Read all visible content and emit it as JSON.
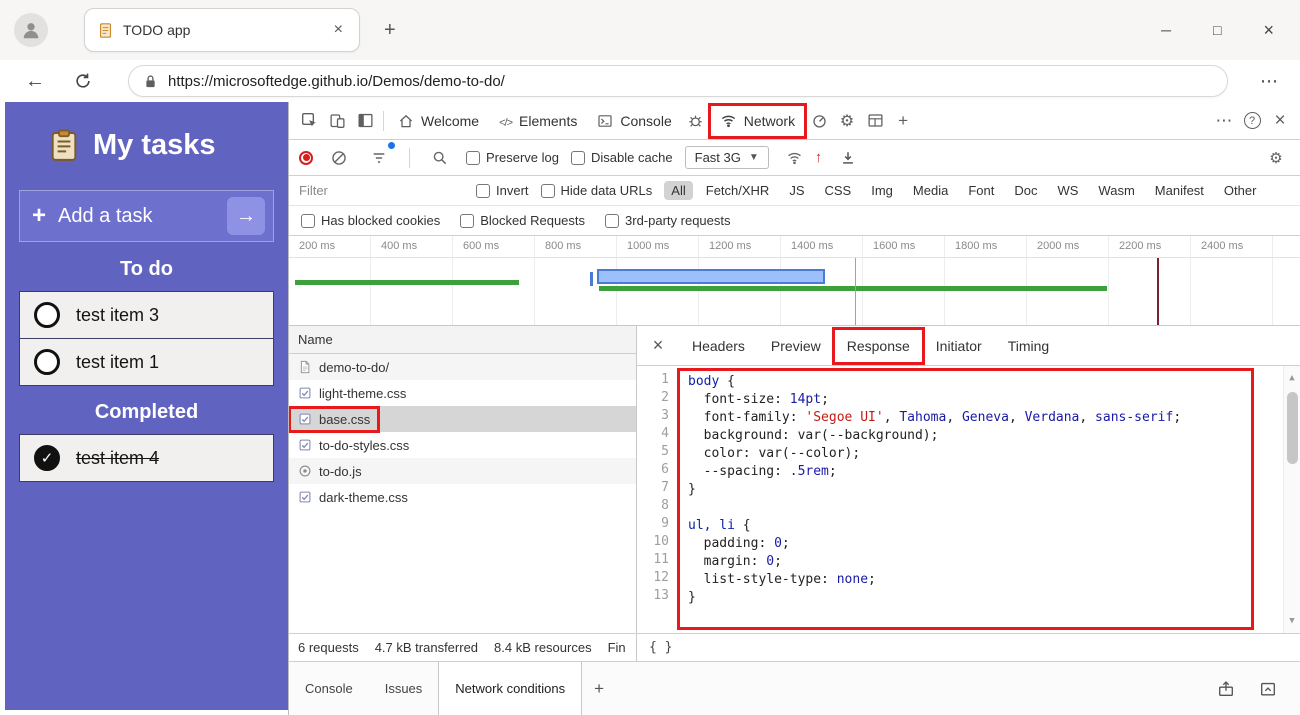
{
  "chrome": {
    "tab": {
      "title": "TODO app"
    },
    "url": "https://microsoftedge.github.io/Demos/demo-to-do/"
  },
  "todo": {
    "title": "My tasks",
    "add_label": "Add a task",
    "sections": [
      {
        "label": "To do",
        "items": [
          {
            "text": "test item 3",
            "done": false
          },
          {
            "text": "test item 1",
            "done": false
          }
        ]
      },
      {
        "label": "Completed",
        "items": [
          {
            "text": "test item 4",
            "done": true
          }
        ]
      }
    ]
  },
  "devtools": {
    "main_tabs": [
      {
        "label": "Welcome",
        "icon": "home-icon"
      },
      {
        "label": "Elements",
        "icon": "elements-icon"
      },
      {
        "label": "Console",
        "icon": "console-icon"
      },
      {
        "label": "Network",
        "icon": "network-icon",
        "highlighted": true
      }
    ],
    "toolbar": {
      "preserve_log": "Preserve log",
      "disable_cache": "Disable cache",
      "throttle_value": "Fast 3G"
    },
    "filters": {
      "placeholder": "Filter",
      "invert": "Invert",
      "hide_data_urls": "Hide data URLs",
      "types": [
        "All",
        "Fetch/XHR",
        "JS",
        "CSS",
        "Img",
        "Media",
        "Font",
        "Doc",
        "WS",
        "Wasm",
        "Manifest",
        "Other"
      ],
      "active_type": "All"
    },
    "request_blocking": [
      "Has blocked cookies",
      "Blocked Requests",
      "3rd-party requests"
    ],
    "timeline_labels": [
      "200 ms",
      "400 ms",
      "600 ms",
      "800 ms",
      "1000 ms",
      "1200 ms",
      "1400 ms",
      "1600 ms",
      "1800 ms",
      "2000 ms",
      "2200 ms",
      "2400 ms"
    ],
    "requests": {
      "header": "Name",
      "rows": [
        {
          "name": "demo-to-do/",
          "icon": "document-icon",
          "selected": false,
          "highlighted": false
        },
        {
          "name": "light-theme.css",
          "icon": "stylesheet-icon",
          "selected": false,
          "highlighted": false
        },
        {
          "name": "base.css",
          "icon": "stylesheet-icon",
          "selected": true,
          "highlighted": true
        },
        {
          "name": "to-do-styles.css",
          "icon": "stylesheet-icon",
          "selected": false,
          "highlighted": false
        },
        {
          "name": "to-do.js",
          "icon": "script-icon",
          "selected": false,
          "highlighted": false
        },
        {
          "name": "dark-theme.css",
          "icon": "stylesheet-icon",
          "selected": false,
          "highlighted": false
        }
      ]
    },
    "response": {
      "tabs": [
        "Headers",
        "Preview",
        "Response",
        "Initiator",
        "Timing"
      ],
      "active_tab": "Response",
      "code": [
        [
          [
            "sel",
            "body"
          ],
          [
            "p",
            " {"
          ]
        ],
        [
          [
            "p",
            "  font-size: "
          ],
          [
            "num",
            "14pt"
          ],
          [
            "p",
            ";"
          ]
        ],
        [
          [
            "p",
            "  font-family: "
          ],
          [
            "str",
            "'Segoe UI'"
          ],
          [
            "p",
            ", "
          ],
          [
            "kw",
            "Tahoma"
          ],
          [
            "p",
            ", "
          ],
          [
            "kw",
            "Geneva"
          ],
          [
            "p",
            ", "
          ],
          [
            "kw",
            "Verdana"
          ],
          [
            "p",
            ", "
          ],
          [
            "kw",
            "sans-serif"
          ],
          [
            "p",
            ";"
          ]
        ],
        [
          [
            "p",
            "  background: var(--background);"
          ]
        ],
        [
          [
            "p",
            "  color: var(--color);"
          ]
        ],
        [
          [
            "p",
            "  --spacing: "
          ],
          [
            "num",
            ".5rem"
          ],
          [
            "p",
            ";"
          ]
        ],
        [
          [
            "p",
            "}"
          ]
        ],
        [
          [
            "p",
            ""
          ]
        ],
        [
          [
            "sel",
            "ul, li"
          ],
          [
            "p",
            " {"
          ]
        ],
        [
          [
            "p",
            "  padding: "
          ],
          [
            "num",
            "0"
          ],
          [
            "p",
            ";"
          ]
        ],
        [
          [
            "p",
            "  margin: "
          ],
          [
            "num",
            "0"
          ],
          [
            "p",
            ";"
          ]
        ],
        [
          [
            "p",
            "  list-style-type: "
          ],
          [
            "kw",
            "none"
          ],
          [
            "p",
            ";"
          ]
        ],
        [
          [
            "p",
            "}"
          ]
        ]
      ]
    },
    "summary": {
      "requests": "6 requests",
      "transferred": "4.7 kB transferred",
      "resources": "8.4 kB resources",
      "finish": "Fin",
      "format_label": "{ }"
    },
    "drawer": {
      "tabs": [
        "Console",
        "Issues",
        "Network conditions"
      ],
      "active": "Network conditions"
    }
  },
  "colors": {
    "annotation_red": "#e8191d",
    "todo_background": "#6163c1",
    "waterfall_green": "#3ca03c",
    "waterfall_blue": "#4b7bd6",
    "event_line_red": "#7c1f2e"
  }
}
